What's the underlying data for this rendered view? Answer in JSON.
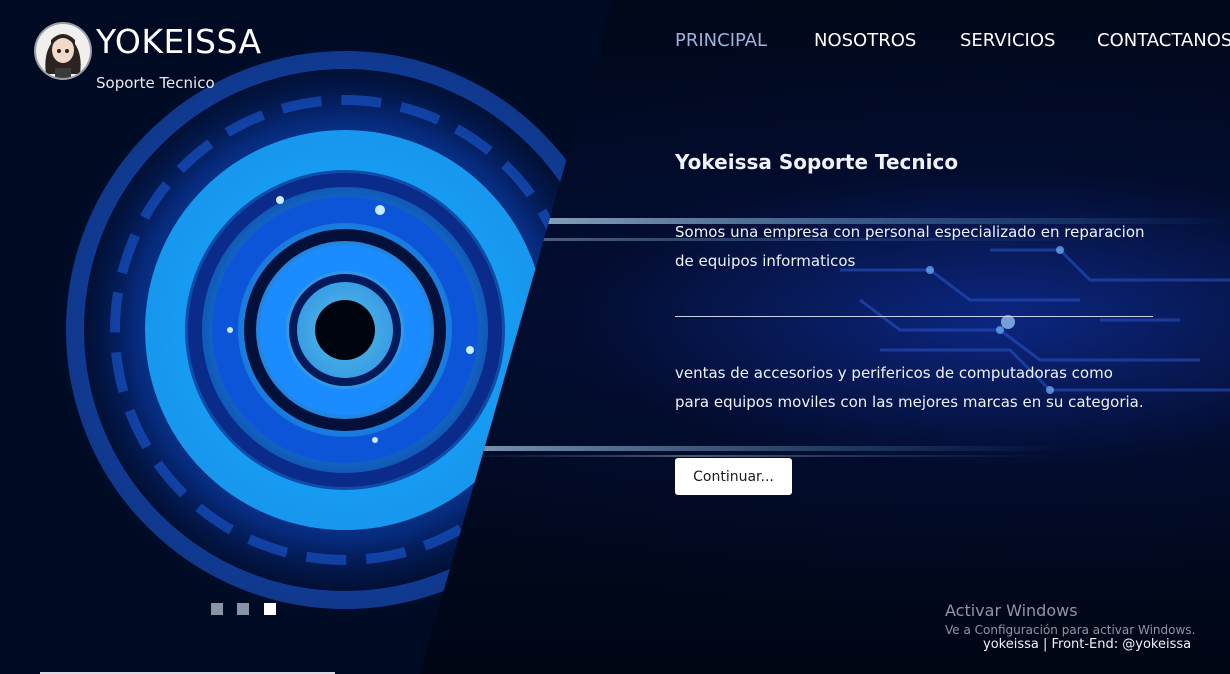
{
  "header": {
    "brand": "YOKEISSA",
    "tagline": "Soporte Tecnico"
  },
  "nav": {
    "items": [
      {
        "label": "PRINCIPAL",
        "active": true
      },
      {
        "label": "NOSOTROS",
        "active": false
      },
      {
        "label": "SERVICIOS",
        "active": false
      },
      {
        "label": "CONTACTANOS",
        "active": false
      }
    ]
  },
  "hero": {
    "title": "Yokeissa Soporte Tecnico",
    "paragraph1": "Somos una empresa con personal especializado en reparacion de equipos informaticos",
    "paragraph2": "ventas de accesorios y perifericos de computadoras como para equipos moviles con las mejores marcas en su categoria.",
    "button_label": "Continuar..."
  },
  "carousel": {
    "slide_count": 3,
    "active_index": 2
  },
  "windows_watermark": {
    "title": "Activar Windows",
    "subtitle": "Ve a Configuración para activar Windows."
  },
  "footer": {
    "credit": "yokeissa | Front-End: @yokeissa"
  },
  "colors": {
    "accent_glow": "#1e9bff",
    "nav_active": "#9fb2da",
    "text": "#ffffff"
  }
}
